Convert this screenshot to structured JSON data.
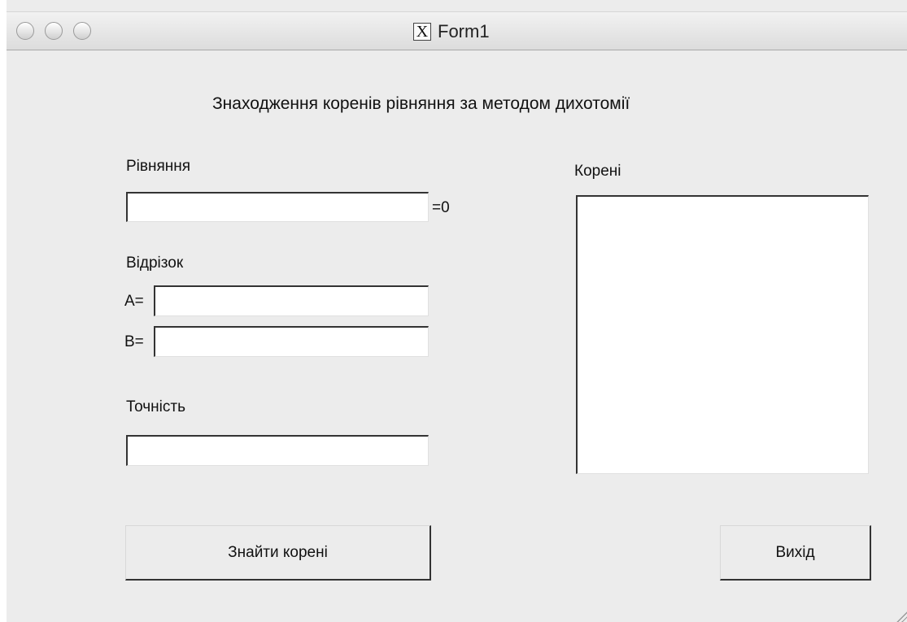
{
  "window": {
    "title": "Form1",
    "app_icon": "x11-icon"
  },
  "form": {
    "heading": "Знаходження коренів рівняння за методом дихотомії",
    "equation_label": "Рівняння",
    "equation_suffix": "=0",
    "equation_value": "",
    "segment_label": "Відрізок",
    "a_label": "A=",
    "a_value": "",
    "b_label": "B=",
    "b_value": "",
    "precision_label": "Точність",
    "precision_value": "",
    "roots_label": "Корені",
    "find_button": "Знайти корені",
    "exit_button": "Вихід"
  }
}
